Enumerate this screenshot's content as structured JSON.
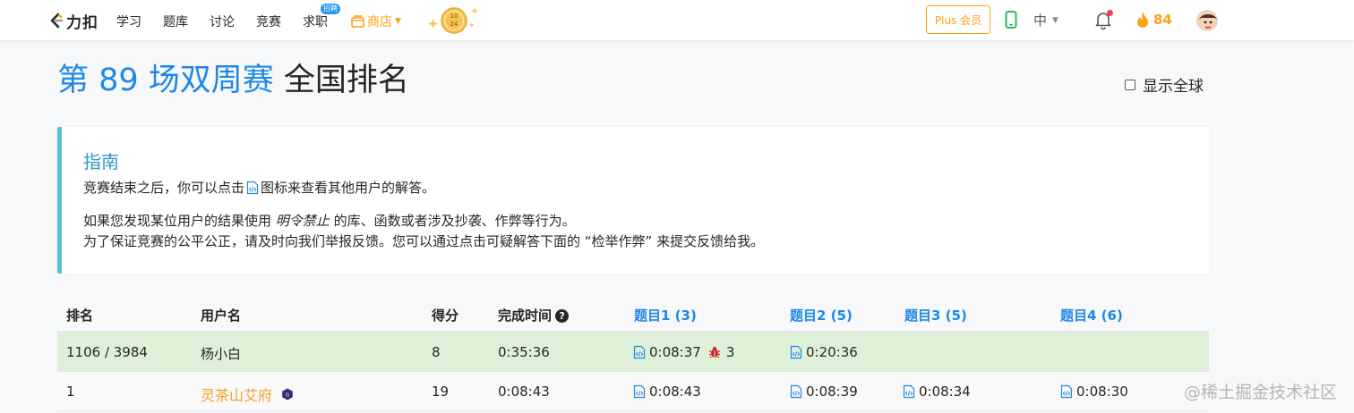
{
  "nav": {
    "logo_text": "力扣",
    "items": [
      "学习",
      "题库",
      "讨论",
      "竞赛",
      "求职"
    ],
    "hire_badge": "招聘",
    "shop_label": "商店",
    "coin_text": "1024",
    "plus_label": "Plus 会员",
    "lang_label": "中",
    "streak_count": "84",
    "accent_color": "#ffa116"
  },
  "title": {
    "contest_link": "第 89 场双周赛",
    "rest": " 全国排名"
  },
  "global_toggle_label": "显示全球",
  "guide": {
    "title": "指南",
    "line1_before": "竞赛结束之后，你可以点击",
    "line1_after": "图标来查看其他用户的解答。",
    "line2_before": "如果您发现某位用户的结果使用 ",
    "line2_em": "明令禁止",
    "line2_after": " 的库、函数或者涉及抄袭、作弊等行为。",
    "line3": "为了保证竞赛的公平公正，请及时向我们举报反馈。您可以通过点击可疑解答下面的 “检举作弊” 来提交反馈给我。"
  },
  "table": {
    "headers": {
      "rank": "排名",
      "username": "用户名",
      "score": "得分",
      "finish_time": "完成时间",
      "q1": "题目1 (3)",
      "q2": "题目2 (5)",
      "q3": "题目3 (5)",
      "q4": "题目4 (6)"
    },
    "rows": [
      {
        "rank": "1106 / 3984",
        "username": "杨小白",
        "score": "8",
        "finish_time": "0:35:36",
        "q1": "0:08:37",
        "q1_bugs": "3",
        "q2": "0:20:36",
        "q3": "",
        "q4": ""
      },
      {
        "rank": "1",
        "username": "灵茶山艾府",
        "score": "19",
        "finish_time": "0:08:43",
        "q1": "0:08:43",
        "q2": "0:08:39",
        "q3": "0:08:34",
        "q4": "0:08:30"
      }
    ]
  },
  "watermark": "@稀土掘金技术社区",
  "colors": {
    "link_blue": "#1e88e5",
    "guide_border": "#5bc0de",
    "my_row": "#dff0d8",
    "user_orange": "#f0a030"
  }
}
